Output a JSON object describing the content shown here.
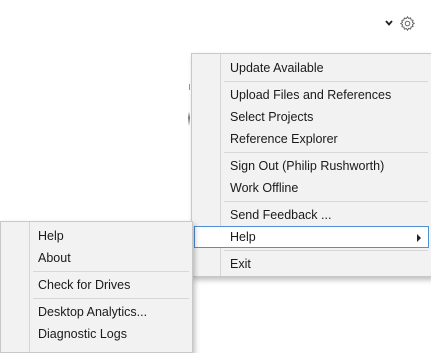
{
  "toolbar": {
    "expand_icon": "chevron-down-icon",
    "settings_icon": "gear-icon"
  },
  "main_menu": {
    "items": [
      {
        "label": "Update Available"
      },
      {
        "label": "Upload Files and References"
      },
      {
        "label": "Select Projects"
      },
      {
        "label": "Reference Explorer"
      },
      {
        "label": "Sign Out (Philip Rushworth)"
      },
      {
        "label": "Work Offline"
      },
      {
        "label": "Send Feedback ..."
      },
      {
        "label": "Help",
        "has_submenu": true,
        "highlighted": true
      },
      {
        "label": "Exit"
      }
    ]
  },
  "help_submenu": {
    "items": [
      {
        "label": "Help"
      },
      {
        "label": "About"
      },
      {
        "label": "Check for Drives"
      },
      {
        "label": "Desktop Analytics..."
      },
      {
        "label": "Diagnostic Logs"
      }
    ]
  },
  "colors": {
    "menu_bg": "#f2f2f2",
    "highlight_border": "#4f8fd6"
  }
}
